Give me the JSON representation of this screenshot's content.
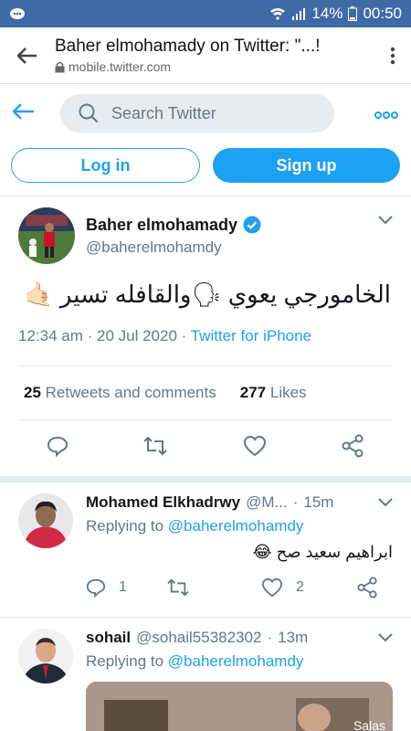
{
  "status_bar": {
    "battery": "14%",
    "time": "00:50"
  },
  "browser": {
    "page_title": "Baher elmohamady on Twitter: \"...!",
    "url": "mobile.twitter.com"
  },
  "header": {
    "search_placeholder": "Search Twitter"
  },
  "auth": {
    "login_label": "Log in",
    "signup_label": "Sign up"
  },
  "tweet": {
    "author_name": "Baher elmohamady",
    "author_handle": "@baherelmohamdy",
    "text": "الخامورجي يعوي 🗣والقافله تسير 🤙🏻",
    "time": "12:34 am",
    "date": "20 Jul 2020",
    "source": "Twitter for iPhone",
    "retweets_count": "25",
    "retweets_label": "Retweets and comments",
    "likes_count": "277",
    "likes_label": "Likes"
  },
  "replies": [
    {
      "name": "Mohamed Elkhadrwy",
      "handle": "@M...",
      "time": "15m",
      "replying_prefix": "Replying to",
      "replying_to": "@baherelmohamdy",
      "text": "ابراهيم سعيد صح 😂",
      "reply_count": "1",
      "like_count": "2"
    },
    {
      "name": "sohail",
      "handle": "@sohail55382302",
      "time": "13m",
      "replying_prefix": "Replying to",
      "replying_to": "@baherelmohamdy",
      "media_caption": "Salas"
    }
  ],
  "colors": {
    "accent": "#1da1f2",
    "status_bar": "#3f6aa6",
    "muted": "#657786"
  }
}
